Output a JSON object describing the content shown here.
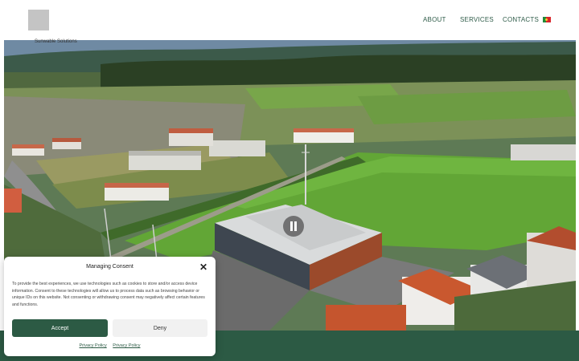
{
  "header": {
    "brand_text": "Sunwable Solutions",
    "nav": [
      {
        "label": "ABOUT"
      },
      {
        "label": "SERVICES"
      },
      {
        "label": "CONTACTS"
      }
    ],
    "language_icon": "portugal-flag-icon"
  },
  "video": {
    "control_icon": "pause-icon"
  },
  "consent": {
    "title": "Managing Consent",
    "close_icon": "close-icon",
    "body": "To provide the best experiences, we use technologies such as cookies to store and/or access device information. Consent to these technologies will allow us to process data such as browsing behavior or unique IDs on this website. Not consenting or withdrawing consent may negatively affect certain features and functions.",
    "accept_label": "Accept",
    "deny_label": "Deny",
    "links": [
      "Privacy Policy",
      "Privacy Policy"
    ]
  },
  "colors": {
    "accent": "#2c5a44",
    "nav_text": "#2f5c49",
    "footer": "#2c5a44"
  }
}
